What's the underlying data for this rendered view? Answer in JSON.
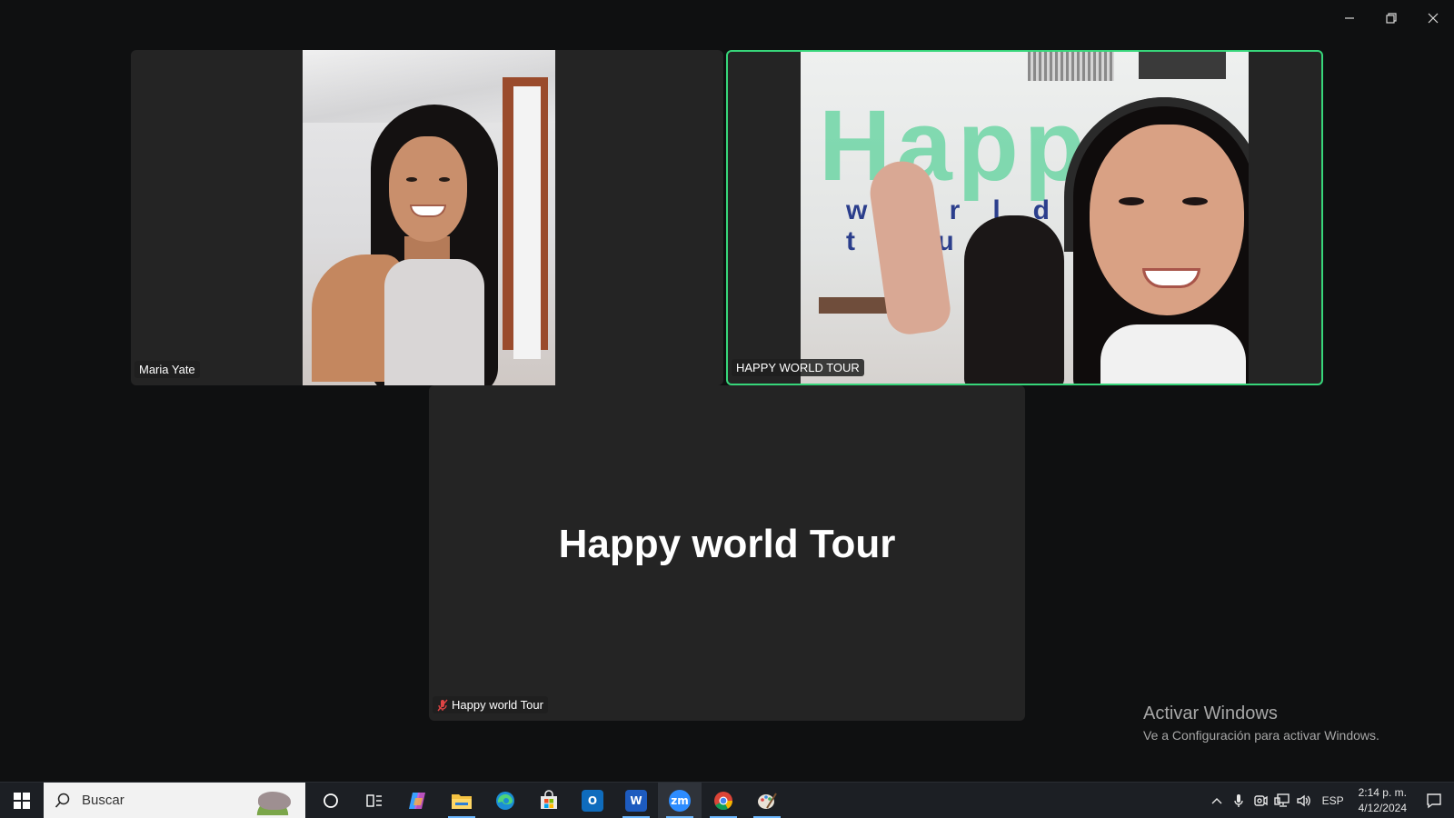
{
  "window": {
    "controls": [
      "minimize",
      "restore",
      "close"
    ]
  },
  "participants": [
    {
      "name": "Maria Yate",
      "video": true,
      "active_speaker": false
    },
    {
      "name": "HAPPY WORLD TOUR",
      "video": true,
      "active_speaker": true,
      "background_logo": "Happ",
      "background_logo_sub": "world tou"
    },
    {
      "name": "Happy world Tour",
      "video": false,
      "muted": true,
      "display_name_large": "Happy world Tour"
    }
  ],
  "watermark": {
    "title": "Activar Windows",
    "subtitle": "Ve a Configuración para activar Windows."
  },
  "taskbar": {
    "search_placeholder": "Buscar",
    "apps": [
      {
        "icon": "cortana-icon"
      },
      {
        "icon": "task-view-icon"
      },
      {
        "icon": "copilot-icon"
      },
      {
        "icon": "file-explorer-icon",
        "running": true
      },
      {
        "icon": "edge-icon"
      },
      {
        "icon": "microsoft-store-icon"
      },
      {
        "icon": "outlook-icon"
      },
      {
        "icon": "word-icon",
        "running": true,
        "label": "W"
      },
      {
        "icon": "zoom-icon",
        "running": true,
        "active": true,
        "label": "zm"
      },
      {
        "icon": "chrome-icon",
        "running": true
      },
      {
        "icon": "paint-icon",
        "running": true
      }
    ],
    "tray": {
      "language": "ESP",
      "time": "2:14 p. m.",
      "date": "4/12/2024"
    }
  },
  "colors": {
    "background": "#0f1011",
    "tile": "#242424",
    "active_speaker_border": "#37d67a",
    "taskbar": "#1c1f24"
  }
}
